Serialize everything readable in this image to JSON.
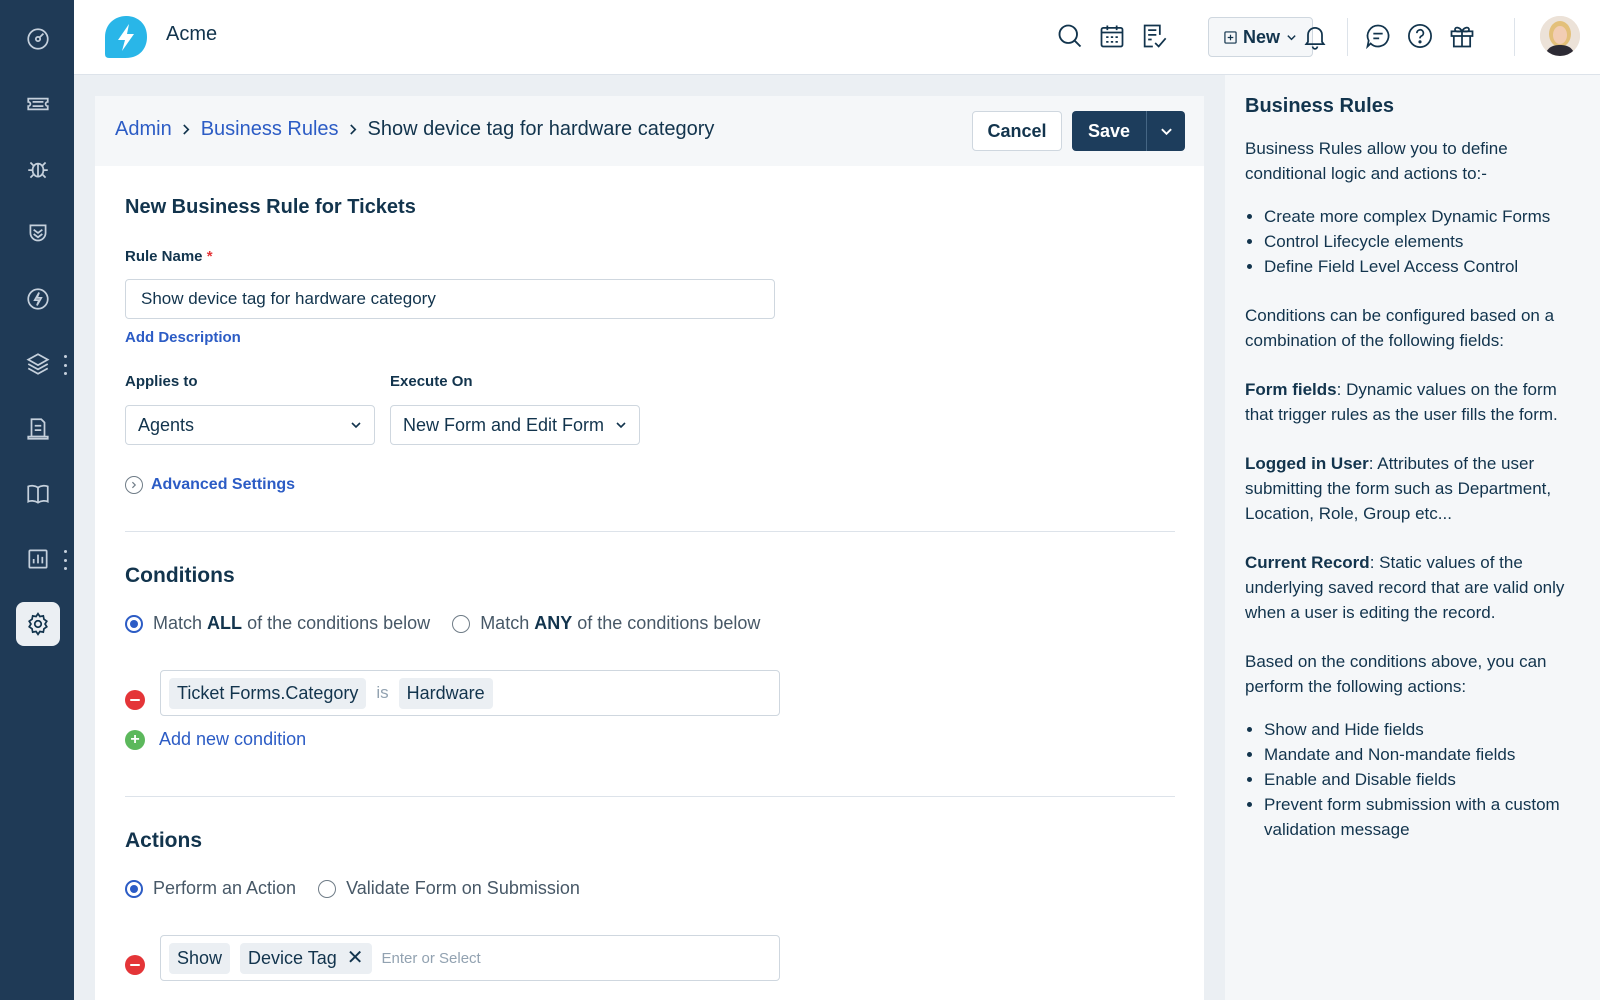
{
  "app": {
    "name": "Acme"
  },
  "topbar": {
    "new_label": "New",
    "icons": [
      "search-icon",
      "calendar-icon",
      "notes-icon",
      "bell-icon",
      "chat-icon",
      "help-icon",
      "gift-icon"
    ]
  },
  "sidebar": {
    "items": [
      "dashboard-icon",
      "tickets-icon",
      "problems-icon",
      "changes-icon",
      "releases-icon",
      "assets-icon",
      "forms-icon",
      "solutions-icon",
      "reports-icon",
      "admin-gear-icon"
    ],
    "active": "admin-gear-icon"
  },
  "breadcrumb": {
    "admin": "Admin",
    "business_rules": "Business Rules",
    "current": "Show device tag for hardware category"
  },
  "actions": {
    "cancel": "Cancel",
    "save": "Save"
  },
  "form": {
    "title": "New Business Rule for Tickets",
    "rule_name_label": "Rule Name",
    "rule_name_required": "*",
    "rule_name_value": "Show device tag for hardware category",
    "add_description": "Add Description",
    "applies_to_label": "Applies to",
    "applies_to_value": "Agents",
    "execute_on_label": "Execute On",
    "execute_on_value": "New Form and Edit Form",
    "advanced_settings": "Advanced Settings"
  },
  "conditions": {
    "title": "Conditions",
    "match_all_pre": "Match",
    "match_all_bold": "ALL",
    "match_all_post": "of the conditions below",
    "match_any_pre": "Match",
    "match_any_bold": "ANY",
    "match_any_post": "of the conditions below",
    "selected": "all",
    "rows": [
      {
        "field": "Ticket Forms.Category",
        "operator": "is",
        "value": "Hardware"
      }
    ],
    "add_new": "Add new condition"
  },
  "actions_section": {
    "title": "Actions",
    "perform_action": "Perform an Action",
    "validate_form": "Validate Form on Submission",
    "selected": "perform",
    "rows": [
      {
        "action": "Show",
        "field": "Device Tag",
        "placeholder": "Enter or Select"
      }
    ]
  },
  "help": {
    "title": "Business Rules",
    "intro": "Business Rules allow you to define conditional logic and actions to:-",
    "list1": [
      "Create more complex Dynamic Forms",
      "Control Lifecycle elements",
      "Define Field Level Access Control"
    ],
    "conditions_text": "Conditions can be configured based on a combination of the following fields:",
    "form_fields_label": "Form fields",
    "form_fields_text": ": Dynamic values on the form that trigger rules as the user fills the form.",
    "logged_user_label": "Logged in User",
    "logged_user_text": ": Attributes of the user submitting the form such as Department, Location, Role, Group etc...",
    "current_record_label": "Current Record",
    "current_record_text": ": Static values of the underlying saved record that are valid only when a user is editing the record.",
    "actions_text": "Based on the conditions above, you can perform the following actions:",
    "list2": [
      "Show and Hide fields",
      "Mandate and Non-mandate fields",
      "Enable and Disable fields",
      "Prevent form submission with a custom validation message"
    ]
  },
  "colors": {
    "sidebar": "#1f3a56",
    "accent": "#2c5cc5",
    "save": "#1d3d5c",
    "danger": "#e43538",
    "success": "#5cb85c"
  }
}
